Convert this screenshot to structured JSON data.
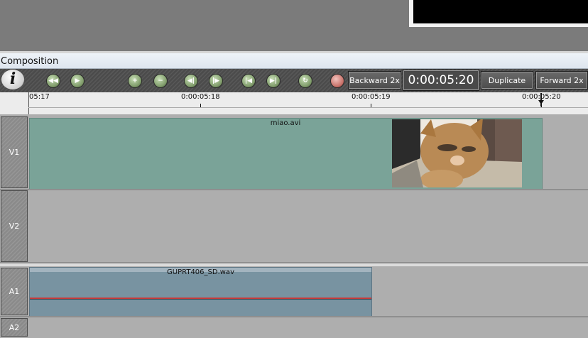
{
  "window": {
    "title": "Composition"
  },
  "toolbar": {
    "logo_glyph": "i",
    "buttons": [
      {
        "name": "rewind",
        "icon": "rewind-icon",
        "glyph": "◀◀"
      },
      {
        "name": "play",
        "icon": "play-icon",
        "glyph": "▶"
      },
      {
        "name": "zoom-in",
        "icon": "plus-icon",
        "glyph": "+"
      },
      {
        "name": "zoom-out",
        "icon": "minus-icon",
        "glyph": "−"
      },
      {
        "name": "mark-in",
        "icon": "mark-in-icon",
        "glyph": "◀|"
      },
      {
        "name": "mark-out",
        "icon": "mark-out-icon",
        "glyph": "|▶"
      },
      {
        "name": "go-start",
        "icon": "skip-start-icon",
        "glyph": "|◀"
      },
      {
        "name": "go-end",
        "icon": "skip-end-icon",
        "glyph": "▶|"
      },
      {
        "name": "loop",
        "icon": "loop-icon",
        "glyph": "↻"
      },
      {
        "name": "record",
        "icon": "record-icon",
        "glyph": ""
      }
    ],
    "backward_label": "Backward 2x",
    "timecode": "0:00:05:20",
    "duplicate_label": "Duplicate",
    "forward_label": "Forward 2x"
  },
  "ruler": {
    "labels": [
      "05:17",
      "0:00:05:18",
      "0:00:05:19",
      "0:00:05:20"
    ]
  },
  "tracks": [
    {
      "label": "V1",
      "clip": "miao.avi"
    },
    {
      "label": "V2",
      "clip": ""
    },
    {
      "label": "A1",
      "clip": "GUPRT406_SD.wav"
    },
    {
      "label": "A2",
      "clip": ""
    }
  ],
  "colors": {
    "video_clip": "#7aa398",
    "audio_clip": "#7893a1",
    "audio_level_line": "#c43a3a",
    "record_button": "#c87169",
    "transport_button": "#7f9b6a"
  }
}
